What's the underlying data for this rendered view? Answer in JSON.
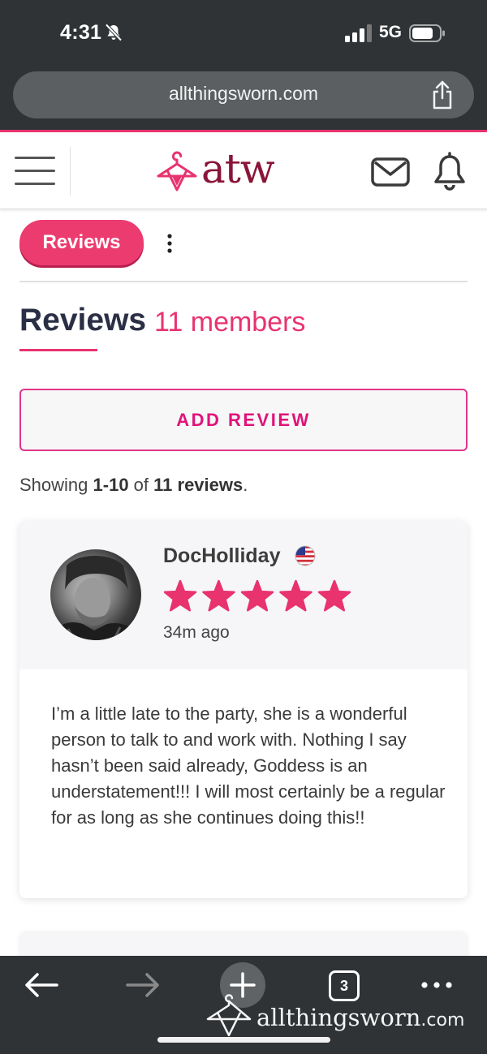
{
  "status_bar": {
    "time": "4:31",
    "network": "5G"
  },
  "browser": {
    "url": "allthingsworn.com",
    "tab_count": "3"
  },
  "header": {
    "logo_text": "atw"
  },
  "tabs": {
    "active_label": "Reviews"
  },
  "section": {
    "title": "Reviews",
    "count_label": "11 members"
  },
  "actions": {
    "add_review_label": "ADD REVIEW"
  },
  "pagination": {
    "prefix": "Showing ",
    "range": "1-10",
    "middle": " of ",
    "total": "11 reviews",
    "suffix": "."
  },
  "reviews": [
    {
      "name": "DocHolliday",
      "rating": 5,
      "rating_max": 5,
      "time_ago": "34m ago",
      "text": "I’m a little late to the party, she is a wonderful person to talk to and work with. Nothing I say hasn’t been said already, Goddess is an understatement!!! I will most certainly be a regular for as long as she continues doing this!!"
    }
  ],
  "watermark": {
    "name": "allthingsworn",
    "tld": ".com"
  },
  "colors": {
    "accent": "#e8336e",
    "brand_dark": "#8a1538",
    "chrome": "#2f3336"
  },
  "icons": [
    "bell-off-icon",
    "signal-icon",
    "battery-icon",
    "share-icon",
    "menu-icon",
    "hanger-logo-icon",
    "mail-icon",
    "bell-icon",
    "kebab-menu-icon",
    "us-flag-icon",
    "star-icon",
    "back-arrow-icon",
    "forward-arrow-icon",
    "plus-icon",
    "more-icon"
  ]
}
